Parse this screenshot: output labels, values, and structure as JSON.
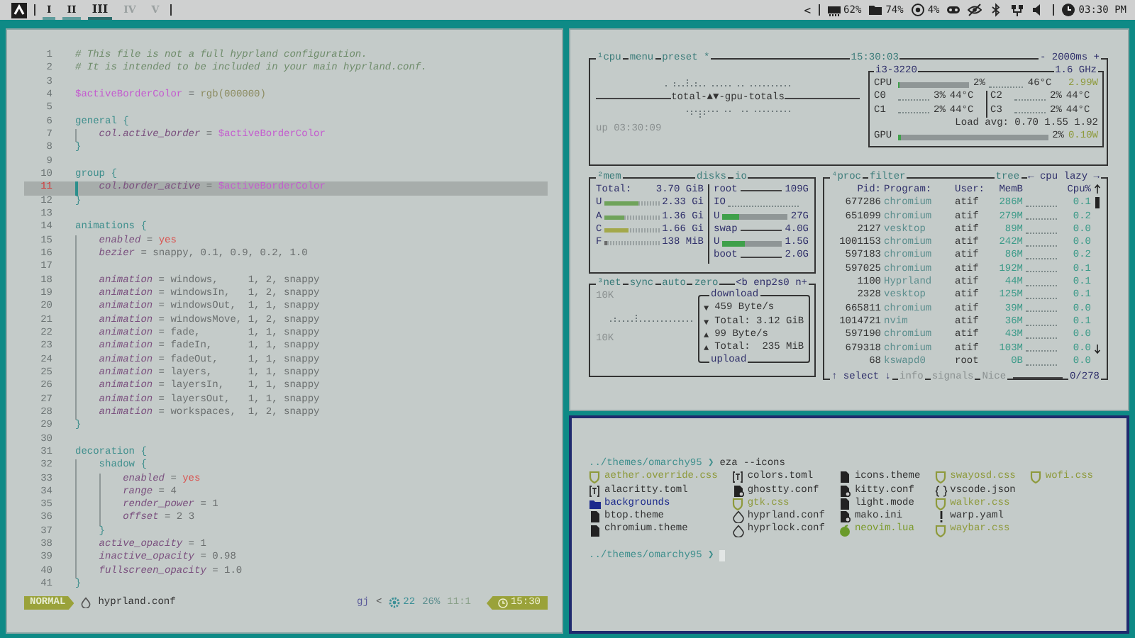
{
  "top_bar": {
    "workspaces": [
      {
        "label": "I",
        "selected": false,
        "occupied": true
      },
      {
        "label": "II",
        "selected": false,
        "occupied": true
      },
      {
        "label": "III",
        "selected": true,
        "occupied": true
      },
      {
        "label": "IV",
        "selected": false,
        "occupied": false
      },
      {
        "label": "V",
        "selected": false,
        "occupied": false
      }
    ],
    "tray_toggle": "<",
    "indicators": [
      {
        "kind": "memory",
        "text": "62%"
      },
      {
        "kind": "disk",
        "text": "74%"
      },
      {
        "kind": "cpu",
        "text": "4%"
      },
      {
        "kind": "gamepad"
      },
      {
        "kind": "eye-off"
      },
      {
        "kind": "bluetooth"
      },
      {
        "kind": "network"
      },
      {
        "kind": "volume"
      },
      {
        "kind": "clock",
        "text": "03:30 PM"
      }
    ]
  },
  "editor": {
    "lines": [
      {
        "number": "1",
        "current": false,
        "tokens": [
          {
            "kind": "comment",
            "text": "# This file is not a full hyprland configuration."
          }
        ]
      },
      {
        "number": "2",
        "current": false,
        "tokens": [
          {
            "kind": "comment",
            "text": "# It is intended to be included in your main hyprland.conf."
          }
        ]
      },
      {
        "number": "3",
        "current": false
      },
      {
        "number": "4",
        "current": false,
        "tokens": [
          {
            "kind": "variable",
            "text": "$activeBorderColor"
          },
          {
            "kind": "plain",
            "text": " = "
          },
          {
            "kind": "function",
            "text": "rgb(000000)"
          }
        ]
      },
      {
        "number": "5",
        "current": false
      },
      {
        "number": "6",
        "current": false,
        "tokens": [
          {
            "kind": "section",
            "text": "general {"
          }
        ],
        "children": [
          {
            "number": "7",
            "current": false,
            "tokens": [
              {
                "kind": "property",
                "text": "col.active_border"
              },
              {
                "kind": "plain",
                "text": " = "
              },
              {
                "kind": "variable",
                "text": "$activeBorderColor"
              }
            ]
          }
        ]
      },
      {
        "number": "8",
        "current": false,
        "tokens": [
          {
            "kind": "section",
            "text": "}"
          }
        ]
      },
      {
        "number": "9",
        "current": false
      },
      {
        "number": "10",
        "current": false,
        "tokens": [
          {
            "kind": "section",
            "text": "group {"
          }
        ],
        "children": [
          {
            "number": "11",
            "current": true,
            "tokens": [
              {
                "kind": "property",
                "text": "col.border_active"
              },
              {
                "kind": "plain",
                "text": " = "
              },
              {
                "kind": "variable",
                "text": "$activeBorderColor"
              }
            ]
          }
        ]
      },
      {
        "number": "12",
        "current": false,
        "tokens": [
          {
            "kind": "section",
            "text": "}"
          }
        ]
      },
      {
        "number": "13",
        "current": false
      },
      {
        "number": "14",
        "current": false,
        "tokens": [
          {
            "kind": "section",
            "text": "animations {"
          }
        ],
        "children": [
          {
            "number": "15",
            "current": false,
            "tokens": [
              {
                "kind": "property",
                "text": "enabled"
              },
              {
                "kind": "plain",
                "text": " = "
              },
              {
                "kind": "boolean",
                "text": "yes"
              }
            ]
          },
          {
            "number": "16",
            "current": false,
            "tokens": [
              {
                "kind": "property",
                "text": "bezier"
              },
              {
                "kind": "plain",
                "text": " = snappy, 0.1, 0.9, 0.2, 1.0"
              }
            ]
          },
          {
            "number": "17",
            "current": false
          },
          {
            "number": "18",
            "current": false,
            "tokens": [
              {
                "kind": "property",
                "text": "animation"
              },
              {
                "kind": "plain",
                "text": " = windows,     1, 2, snappy"
              }
            ]
          },
          {
            "number": "19",
            "current": false,
            "tokens": [
              {
                "kind": "property",
                "text": "animation"
              },
              {
                "kind": "plain",
                "text": " = windowsIn,   1, 2, snappy"
              }
            ]
          },
          {
            "number": "20",
            "current": false,
            "tokens": [
              {
                "kind": "property",
                "text": "animation"
              },
              {
                "kind": "plain",
                "text": " = windowsOut,  1, 1, snappy"
              }
            ]
          },
          {
            "number": "21",
            "current": false,
            "tokens": [
              {
                "kind": "property",
                "text": "animation"
              },
              {
                "kind": "plain",
                "text": " = windowsMove, 1, 2, snappy"
              }
            ]
          },
          {
            "number": "22",
            "current": false,
            "tokens": [
              {
                "kind": "property",
                "text": "animation"
              },
              {
                "kind": "plain",
                "text": " = fade,        1, 1, snappy"
              }
            ]
          },
          {
            "number": "23",
            "current": false,
            "tokens": [
              {
                "kind": "property",
                "text": "animation"
              },
              {
                "kind": "plain",
                "text": " = fadeIn,      1, 1, snappy"
              }
            ]
          },
          {
            "number": "24",
            "current": false,
            "tokens": [
              {
                "kind": "property",
                "text": "animation"
              },
              {
                "kind": "plain",
                "text": " = fadeOut,     1, 1, snappy"
              }
            ]
          },
          {
            "number": "25",
            "current": false,
            "tokens": [
              {
                "kind": "property",
                "text": "animation"
              },
              {
                "kind": "plain",
                "text": " = layers,      1, 1, snappy"
              }
            ]
          },
          {
            "number": "26",
            "current": false,
            "tokens": [
              {
                "kind": "property",
                "text": "animation"
              },
              {
                "kind": "plain",
                "text": " = layersIn,    1, 1, snappy"
              }
            ]
          },
          {
            "number": "27",
            "current": false,
            "tokens": [
              {
                "kind": "property",
                "text": "animation"
              },
              {
                "kind": "plain",
                "text": " = layersOut,   1, 1, snappy"
              }
            ]
          },
          {
            "number": "28",
            "current": false,
            "tokens": [
              {
                "kind": "property",
                "text": "animation"
              },
              {
                "kind": "plain",
                "text": " = workspaces,  1, 2, snappy"
              }
            ]
          }
        ]
      },
      {
        "number": "29",
        "current": false,
        "tokens": [
          {
            "kind": "section",
            "text": "}"
          }
        ]
      },
      {
        "number": "30",
        "current": false
      },
      {
        "number": "31",
        "current": false,
        "tokens": [
          {
            "kind": "section",
            "text": "decoration {"
          }
        ],
        "children": [
          {
            "number": "32",
            "current": false,
            "tokens": [
              {
                "kind": "section",
                "text": "shadow {"
              }
            ],
            "children": [
              {
                "number": "33",
                "current": false,
                "tokens": [
                  {
                    "kind": "property",
                    "text": "enabled"
                  },
                  {
                    "kind": "plain",
                    "text": " = "
                  },
                  {
                    "kind": "boolean",
                    "text": "yes"
                  }
                ]
              },
              {
                "number": "34",
                "current": false,
                "tokens": [
                  {
                    "kind": "property",
                    "text": "range"
                  },
                  {
                    "kind": "plain",
                    "text": " = 4"
                  }
                ]
              },
              {
                "number": "35",
                "current": false,
                "tokens": [
                  {
                    "kind": "property",
                    "text": "render_power"
                  },
                  {
                    "kind": "plain",
                    "text": " = 1"
                  }
                ]
              },
              {
                "number": "36",
                "current": false,
                "tokens": [
                  {
                    "kind": "property",
                    "text": "offset"
                  },
                  {
                    "kind": "plain",
                    "text": " = 2 3"
                  }
                ]
              }
            ]
          },
          {
            "number": "37",
            "current": false,
            "tokens": [
              {
                "kind": "section",
                "text": "}"
              }
            ]
          },
          {
            "number": "38",
            "current": false,
            "tokens": [
              {
                "kind": "property",
                "text": "active_opacity"
              },
              {
                "kind": "plain",
                "text": " = 1"
              }
            ]
          },
          {
            "number": "39",
            "current": false,
            "tokens": [
              {
                "kind": "property",
                "text": "inactive_opacity"
              },
              {
                "kind": "plain",
                "text": " = 0.98"
              }
            ]
          },
          {
            "number": "40",
            "current": false,
            "tokens": [
              {
                "kind": "property",
                "text": "fullscreen_opacity"
              },
              {
                "kind": "plain",
                "text": " = 1.0"
              }
            ]
          }
        ]
      },
      {
        "number": "41",
        "current": false,
        "tokens": [
          {
            "kind": "section",
            "text": "}"
          }
        ]
      }
    ],
    "status_line": {
      "mode": "NORMAL",
      "file": "hyprland.conf",
      "keys": "gj",
      "separator": "<",
      "diagnostics": "22",
      "progress": "26%",
      "position": "11:1",
      "time": "15:30"
    }
  },
  "btop": {
    "cpu": {
      "tabs": [
        "¹cpu",
        "menu",
        "preset *"
      ],
      "clock": "15:30:03",
      "interval": "- 2000ms +",
      "graph_label": "total-▲▼-gpu-totals",
      "uptime": "up 03:30:09",
      "model": "i3-3220",
      "frequency": "1.6 GHz",
      "total": {
        "label": "CPU",
        "level": 0.02,
        "percent": "2%",
        "temp": "46°C",
        "power": "2.99W"
      },
      "cores": [
        {
          "label": "C0",
          "percent": "3%",
          "temp": "44°C"
        },
        {
          "label": "C2",
          "percent": "2%",
          "temp": "44°C"
        },
        {
          "label": "C1",
          "percent": "2%",
          "temp": "44°C"
        },
        {
          "label": "C3",
          "percent": "2%",
          "temp": "44°C"
        }
      ],
      "load": "Load avg: 0.70 1.55 1.92",
      "gpu": {
        "label": "GPU",
        "level": 0.02,
        "percent": "2%",
        "power": "0.10W"
      }
    },
    "mem": {
      "title": "²mem",
      "total_label": "Total:",
      "total_value": "3.70 GiB",
      "rows": [
        {
          "label": "U",
          "level": 0.63,
          "value": "2.33 Gi",
          "color": "#6fa35a"
        },
        {
          "label": "A",
          "level": 0.37,
          "value": "1.36 Gi",
          "color": "#6fa35a"
        },
        {
          "label": "C",
          "level": 0.45,
          "value": "1.66 Gi",
          "color": "#a3a84a"
        },
        {
          "label": "F",
          "level": 0.04,
          "value": "138 MiB",
          "color": "#6a6a6a"
        }
      ]
    },
    "disks": {
      "title": "disks",
      "io_title": "io",
      "rows": [
        {
          "kind": "mount",
          "label": "root",
          "value": "109G"
        },
        {
          "kind": "io",
          "label": "IO"
        },
        {
          "kind": "usage",
          "label": "U",
          "level": 0.25,
          "value": "27G"
        },
        {
          "kind": "mount",
          "label": "swap",
          "value": "4.0G"
        },
        {
          "kind": "usage",
          "label": "U",
          "level": 0.37,
          "value": "1.5G"
        },
        {
          "kind": "mount",
          "label": "boot",
          "value": "2.0G"
        }
      ]
    },
    "net": {
      "tabs": [
        "³net",
        "sync",
        "auto",
        "zero"
      ],
      "interface": "<b enp2s0 n+",
      "scale_top": "10K",
      "scale_bottom": "10K",
      "download_title": "download",
      "upload_title": "upload",
      "stats": [
        {
          "arrow": "▼",
          "text": "459 Byte/s"
        },
        {
          "arrow": "▼",
          "text": "Total: 3.12 GiB"
        },
        {
          "arrow": "▲",
          "text": "99 Byte/s"
        },
        {
          "arrow": "▲",
          "text": "Total:  235 MiB"
        }
      ]
    },
    "proc": {
      "tabs": [
        "⁴proc",
        "filter"
      ],
      "tree": "tree",
      "sort": "← cpu lazy →",
      "columns": [
        "Pid:",
        "Program:",
        "User:",
        "MemB",
        "Cpu%"
      ],
      "rows": [
        {
          "pid": "677286",
          "program": "chromium",
          "user": "atif",
          "mem": "286M",
          "cpu": "0.1"
        },
        {
          "pid": "651099",
          "program": "chromium",
          "user": "atif",
          "mem": "279M",
          "cpu": "0.2"
        },
        {
          "pid": "2127",
          "program": "vesktop",
          "user": "atif",
          "mem": "89M",
          "cpu": "0.0"
        },
        {
          "pid": "1001153",
          "program": "chromium",
          "user": "atif",
          "mem": "242M",
          "cpu": "0.0"
        },
        {
          "pid": "597183",
          "program": "chromium",
          "user": "atif",
          "mem": "86M",
          "cpu": "0.2"
        },
        {
          "pid": "597025",
          "program": "chromium",
          "user": "atif",
          "mem": "192M",
          "cpu": "0.1"
        },
        {
          "pid": "1100",
          "program": "Hyprland",
          "user": "atif",
          "mem": "44M",
          "cpu": "0.1"
        },
        {
          "pid": "2328",
          "program": "vesktop",
          "user": "atif",
          "mem": "125M",
          "cpu": "0.1"
        },
        {
          "pid": "665811",
          "program": "chromium",
          "user": "atif",
          "mem": "39M",
          "cpu": "0.0"
        },
        {
          "pid": "1014721",
          "program": "nvim",
          "user": "atif",
          "mem": "36M",
          "cpu": "0.1"
        },
        {
          "pid": "597190",
          "program": "chromium",
          "user": "atif",
          "mem": "43M",
          "cpu": "0.0"
        },
        {
          "pid": "679318",
          "program": "chromium",
          "user": "atif",
          "mem": "103M",
          "cpu": "0.0"
        },
        {
          "pid": "68",
          "program": "kswapd0",
          "user": "root",
          "mem": "0B",
          "cpu": "0.0"
        }
      ],
      "footer": [
        "↑ select ↓",
        "info",
        "signals",
        "Nice"
      ],
      "count": "0/278"
    }
  },
  "terminal": {
    "prompt": "../themes/omarchy95 ❯",
    "command": "eza --icons",
    "files": [
      {
        "name": "aether.override.css",
        "kind": "css"
      },
      {
        "name": "alacritty.toml",
        "kind": "toml"
      },
      {
        "name": "backgrounds",
        "kind": "folder"
      },
      {
        "name": "btop.theme",
        "kind": "theme"
      },
      {
        "name": "chromium.theme",
        "kind": "theme"
      },
      {
        "name": "colors.toml",
        "kind": "toml"
      },
      {
        "name": "ghostty.conf",
        "kind": "conf"
      },
      {
        "name": "gtk.css",
        "kind": "css"
      },
      {
        "name": "hyprland.conf",
        "kind": "hypr"
      },
      {
        "name": "hyprlock.conf",
        "kind": "hypr"
      },
      {
        "name": "icons.theme",
        "kind": "theme"
      },
      {
        "name": "kitty.conf",
        "kind": "conf"
      },
      {
        "name": "light.mode",
        "kind": "theme"
      },
      {
        "name": "mako.ini",
        "kind": "conf"
      },
      {
        "name": "neovim.lua",
        "kind": "lua"
      },
      {
        "name": "swayosd.css",
        "kind": "css"
      },
      {
        "name": "vscode.json",
        "kind": "json"
      },
      {
        "name": "walker.css",
        "kind": "css"
      },
      {
        "name": "warp.yaml",
        "kind": "yaml"
      },
      {
        "name": "waybar.css",
        "kind": "css"
      },
      {
        "name": "wofi.css",
        "kind": "css"
      }
    ],
    "prompt_2": "../themes/omarchy95 ❯"
  }
}
